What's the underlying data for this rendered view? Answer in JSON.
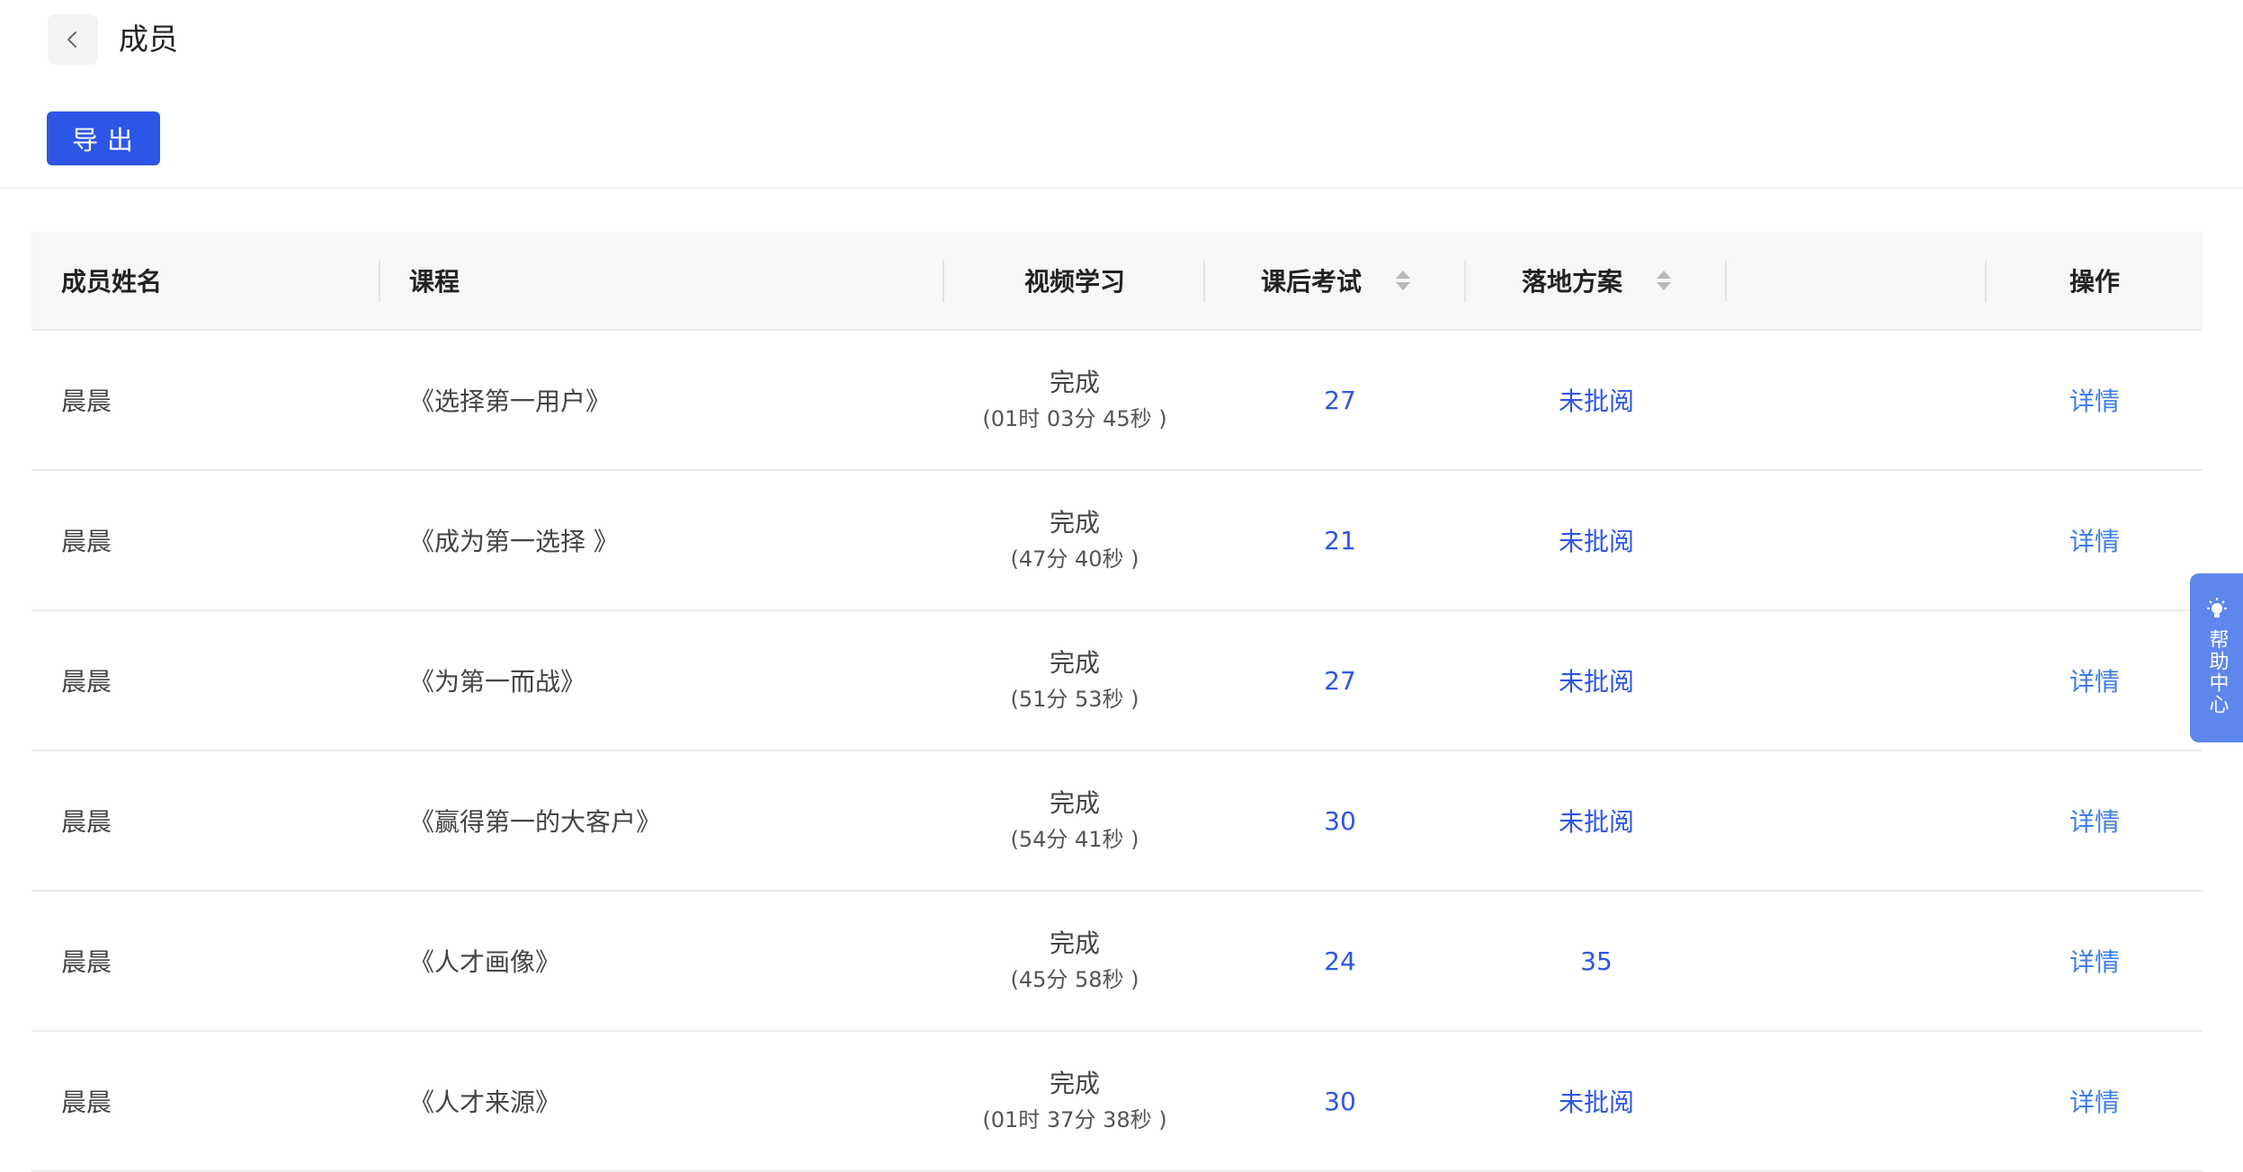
{
  "header": {
    "title": "成员",
    "export_label": "导出"
  },
  "table": {
    "columns": {
      "name": "成员姓名",
      "course": "课程",
      "video": "视频学习",
      "exam": "课后考试",
      "plan": "落地方案",
      "action": "操作"
    },
    "rows": [
      {
        "name": "晨晨",
        "course": "《选择第一用户》",
        "video_status": "完成",
        "video_duration": "(01时 03分 45秒 )",
        "exam": "27",
        "plan": "未批阅",
        "action": "详情"
      },
      {
        "name": "晨晨",
        "course": "《成为第一选择 》",
        "video_status": "完成",
        "video_duration": "(47分 40秒 )",
        "exam": "21",
        "plan": "未批阅",
        "action": "详情"
      },
      {
        "name": "晨晨",
        "course": "《为第一而战》",
        "video_status": "完成",
        "video_duration": "(51分 53秒 )",
        "exam": "27",
        "plan": "未批阅",
        "action": "详情"
      },
      {
        "name": "晨晨",
        "course": "《赢得第一的大客户》",
        "video_status": "完成",
        "video_duration": "(54分 41秒 )",
        "exam": "30",
        "plan": "未批阅",
        "action": "详情"
      },
      {
        "name": "晨晨",
        "course": "《人才画像》",
        "video_status": "完成",
        "video_duration": "(45分 58秒 )",
        "exam": "24",
        "plan": "35",
        "action": "详情"
      },
      {
        "name": "晨晨",
        "course": "《人才来源》",
        "video_status": "完成",
        "video_duration": "(01时 37分 38秒 )",
        "exam": "30",
        "plan": "未批阅",
        "action": "详情"
      }
    ]
  },
  "help": {
    "label": "帮助中心",
    "icon": "lightbulb-icon"
  },
  "colors": {
    "primary": "#2d55e6",
    "link": "#3d7ee8",
    "help_tab": "#5f86ec"
  }
}
